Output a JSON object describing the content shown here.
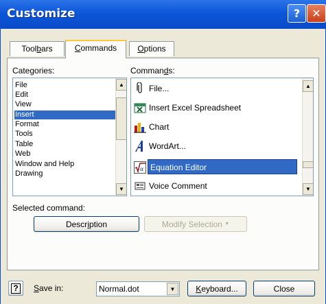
{
  "window": {
    "title": "Customize",
    "help_glyph": "?",
    "close_glyph": "✕"
  },
  "tabs": [
    {
      "label_pre": "Tool",
      "label_u": "b",
      "label_post": "ars",
      "active": false
    },
    {
      "label_pre": "",
      "label_u": "C",
      "label_post": "ommands",
      "active": true
    },
    {
      "label_pre": "",
      "label_u": "O",
      "label_post": "ptions",
      "active": false
    }
  ],
  "categories": {
    "label_pre": "Cate",
    "label_u": "g",
    "label_post": "ories:",
    "items": [
      "File",
      "Edit",
      "View",
      "Insert",
      "Format",
      "Tools",
      "Table",
      "Web",
      "Window and Help",
      "Drawing"
    ],
    "selected": "Insert"
  },
  "commands": {
    "label_pre": "Comman",
    "label_u": "d",
    "label_post": "s:",
    "items": [
      {
        "label": "File...",
        "icon": "paperclip-icon"
      },
      {
        "label": "Insert Excel Spreadsheet",
        "icon": "excel-spreadsheet-icon"
      },
      {
        "label": "Chart",
        "icon": "chart-icon"
      },
      {
        "label": "WordArt...",
        "icon": "wordart-icon"
      },
      {
        "label": "Equation Editor",
        "icon": "equation-icon"
      },
      {
        "label": "Voice Comment",
        "icon": "voice-comment-icon"
      }
    ],
    "selected": "Equation Editor"
  },
  "selected_command": {
    "label": "Selected command:",
    "description_pre": "Descr",
    "description_u": "i",
    "description_post": "ption",
    "modify_label": "Modify Selection",
    "modify_arrow": "▼"
  },
  "footer": {
    "help_glyph": "?",
    "save_in_pre": "",
    "save_in_u": "S",
    "save_in_post": "ave in:",
    "save_in_value": "Normal.dot",
    "keyboard_pre": "",
    "keyboard_u": "K",
    "keyboard_post": "eyboard...",
    "close_label": "Close"
  },
  "colors": {
    "title_bar": "#0A4BC9",
    "selection": "#316AC5",
    "dialog_bg": "#ECE9D8"
  }
}
